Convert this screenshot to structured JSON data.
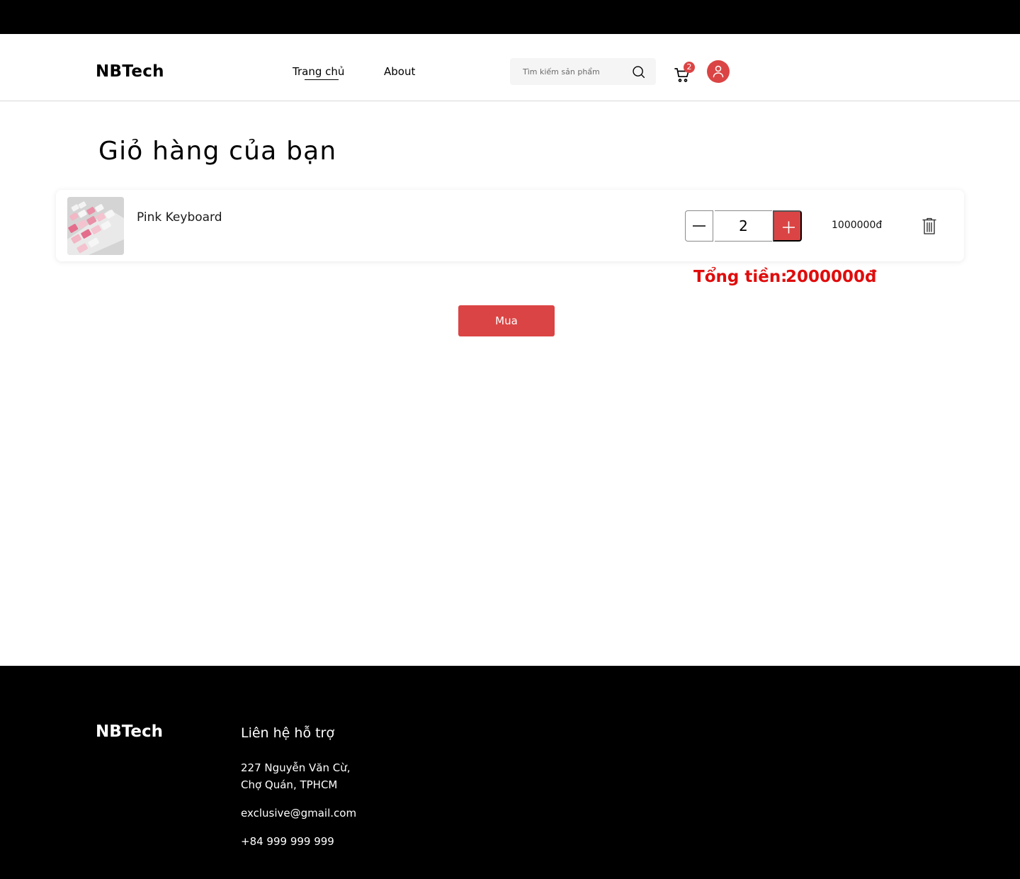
{
  "header": {
    "logo": "NBTech",
    "nav": [
      {
        "label": "Trang chủ"
      },
      {
        "label": "About"
      }
    ],
    "search": {
      "placeholder": "Tìm kiếm sản phẩm",
      "icon": "search-icon"
    },
    "cart": {
      "icon": "cart-icon",
      "badge_count": "2"
    },
    "account": {
      "icon": "user-icon"
    }
  },
  "main": {
    "title": "Giỏ hàng của bạn",
    "cart_items": [
      {
        "name": "Pink Keyboard",
        "quantity": "2",
        "price": "1000000đ",
        "thumbnail": "pink keyboard photo"
      }
    ],
    "total_label": "Tổng tiền:",
    "total_value": "2000000đ",
    "buy_label": "Mua"
  },
  "footer": {
    "logo": "NBTech",
    "heading": "Liên hệ hỗ trợ",
    "address_line1": "227 Nguyễn Văn Cừ,",
    "address_line2": "Chợ Quán, TPHCM",
    "email": "exclusive@gmail.com",
    "phone": "+84 999 999 999"
  },
  "colors": {
    "accent": "#db4444",
    "total_text": "#e00c0c",
    "footer_bg": "#000000"
  }
}
